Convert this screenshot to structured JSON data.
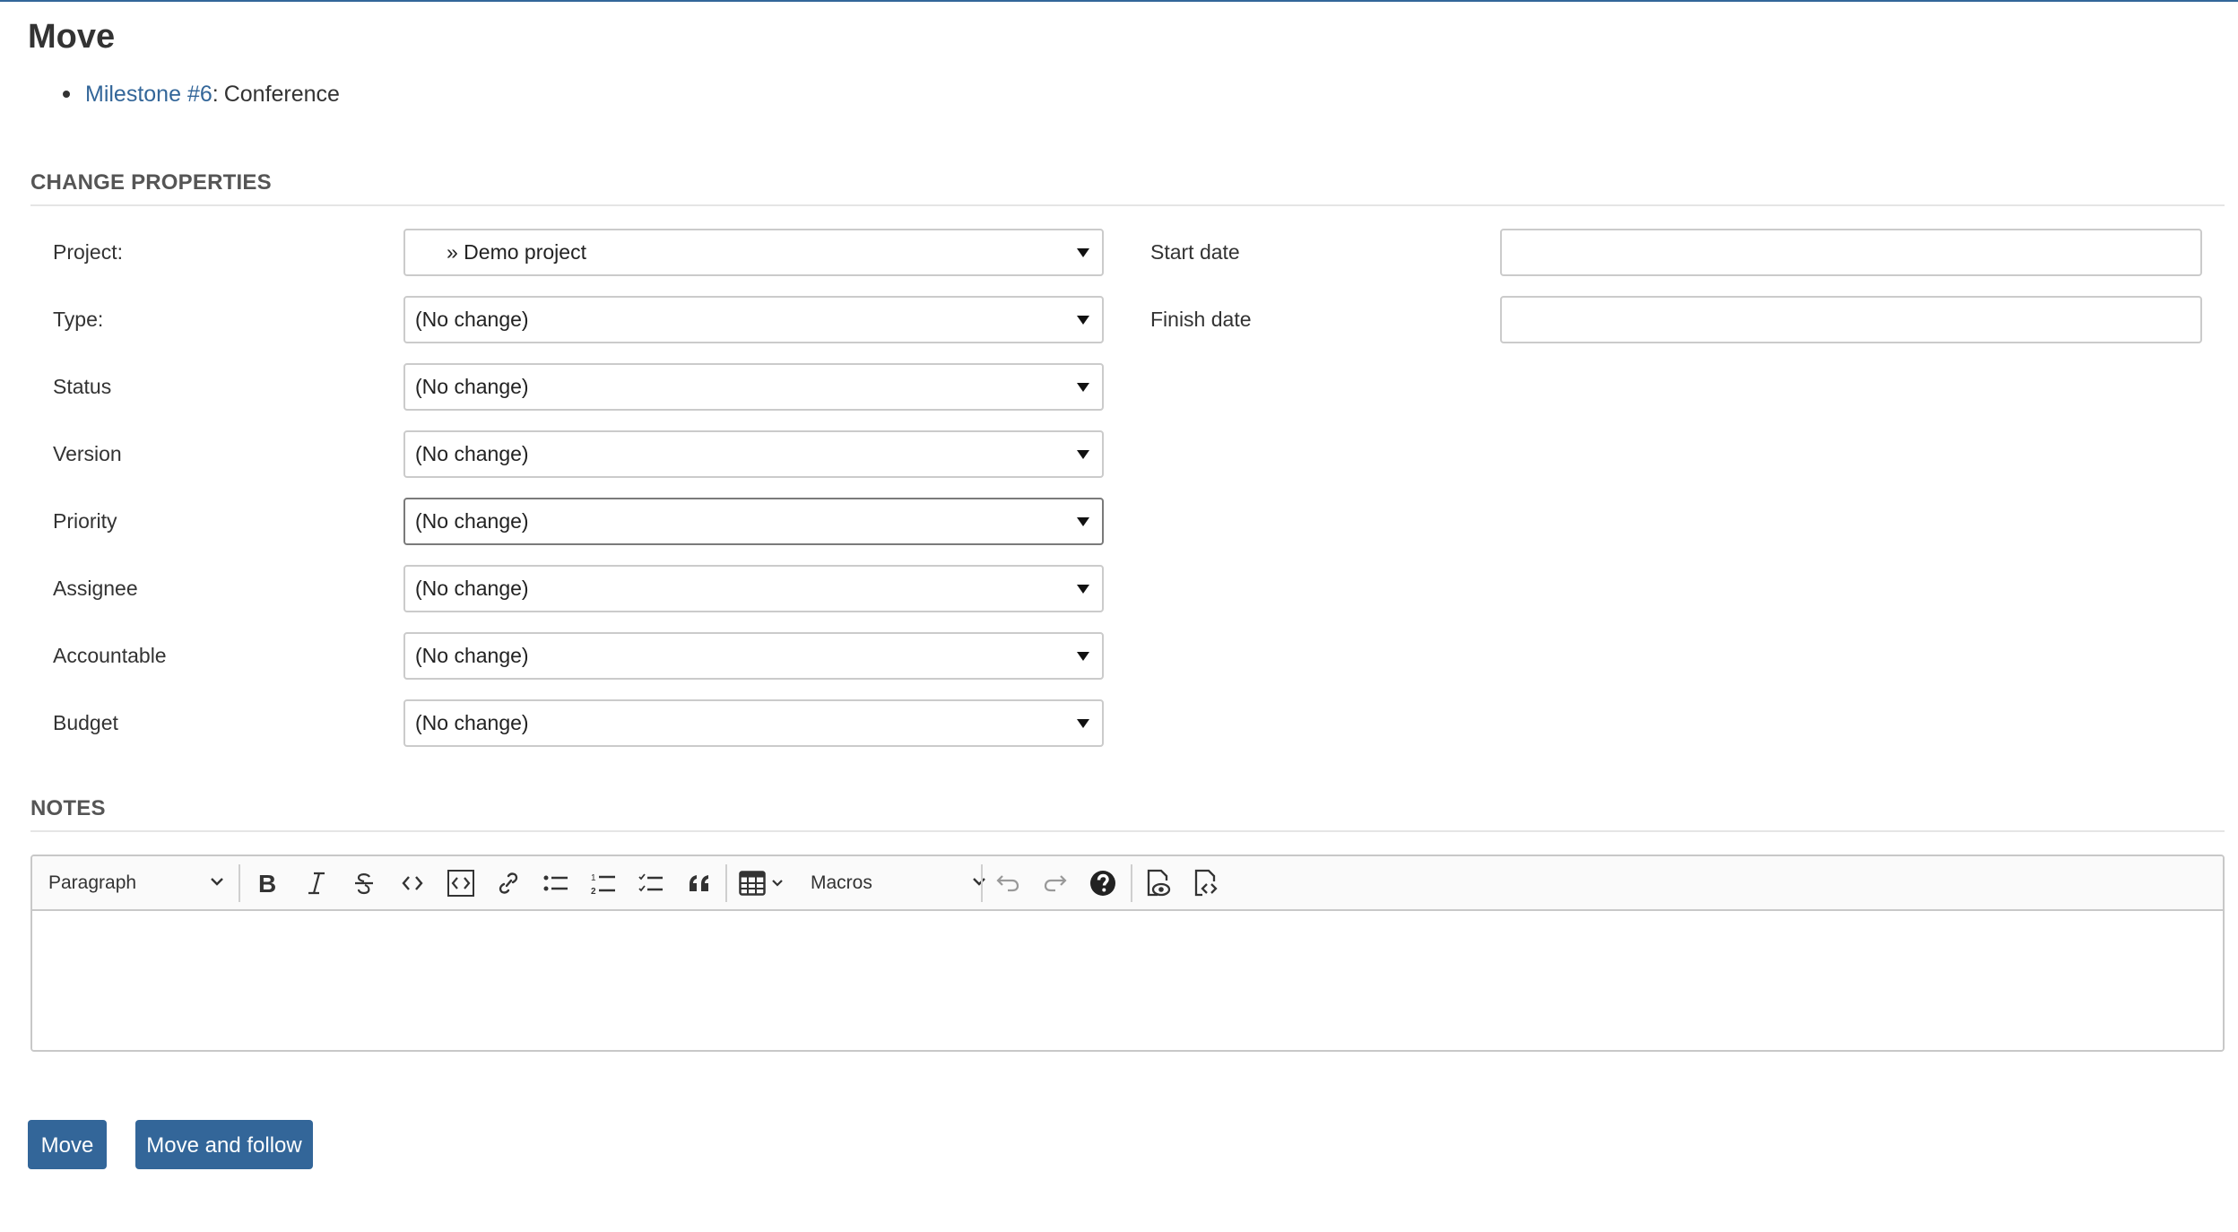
{
  "page": {
    "title": "Move",
    "work_package": {
      "link_label": "Milestone #6",
      "separator": ":",
      "subject": "Conference"
    }
  },
  "change_properties": {
    "section_title": "CHANGE PROPERTIES",
    "fields": [
      {
        "label": "Project:",
        "value": "» Demo project"
      },
      {
        "label": "Type:",
        "value": "(No change)"
      },
      {
        "label": "Status",
        "value": "(No change)"
      },
      {
        "label": "Version",
        "value": "(No change)"
      },
      {
        "label": "Priority",
        "value": "(No change)"
      },
      {
        "label": "Assignee",
        "value": "(No change)"
      },
      {
        "label": "Accountable",
        "value": "(No change)"
      },
      {
        "label": "Budget",
        "value": "(No change)"
      }
    ],
    "dates": [
      {
        "label": "Start date",
        "value": ""
      },
      {
        "label": "Finish date",
        "value": ""
      }
    ]
  },
  "notes": {
    "section_title": "NOTES",
    "toolbar": {
      "heading_dropdown": "Paragraph",
      "macros_dropdown": "Macros",
      "buttons": [
        "bold",
        "italic",
        "strikethrough",
        "code",
        "code-block",
        "link",
        "bulleted-list",
        "numbered-list",
        "todo-list",
        "blockquote",
        "table",
        "undo",
        "redo",
        "help",
        "preview",
        "source"
      ]
    },
    "content": ""
  },
  "actions": {
    "move_label": "Move",
    "move_follow_label": "Move and follow"
  },
  "colors": {
    "accent": "#336699",
    "text": "#333333"
  }
}
